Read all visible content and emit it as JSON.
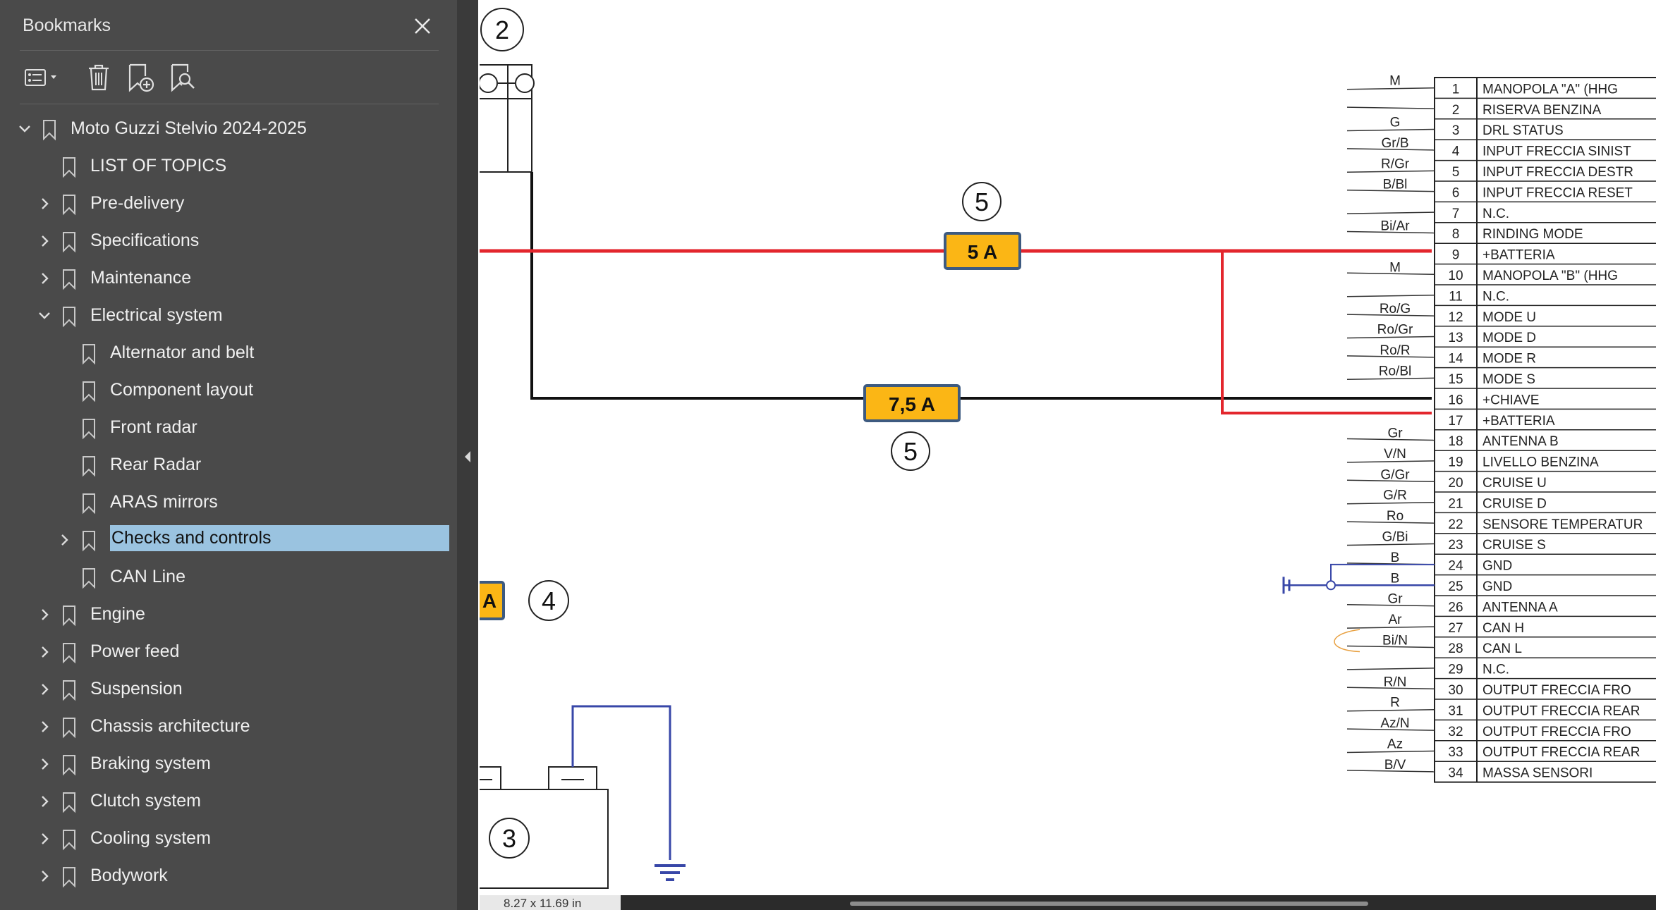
{
  "sidebar": {
    "title": "Bookmarks",
    "tree": [
      {
        "label": "Moto Guzzi Stelvio 2024-2025",
        "level": 0,
        "expander": "expanded"
      },
      {
        "label": "LIST OF TOPICS",
        "level": 1,
        "expander": "none"
      },
      {
        "label": "Pre-delivery",
        "level": 1,
        "expander": "collapsed"
      },
      {
        "label": "Specifications",
        "level": 1,
        "expander": "collapsed"
      },
      {
        "label": "Maintenance",
        "level": 1,
        "expander": "collapsed"
      },
      {
        "label": "Electrical system",
        "level": 1,
        "expander": "expanded"
      },
      {
        "label": "Alternator and belt",
        "level": 2,
        "expander": "none"
      },
      {
        "label": "Component layout",
        "level": 2,
        "expander": "none"
      },
      {
        "label": "Front radar",
        "level": 2,
        "expander": "none"
      },
      {
        "label": "Rear Radar",
        "level": 2,
        "expander": "none"
      },
      {
        "label": "ARAS mirrors",
        "level": 2,
        "expander": "none"
      },
      {
        "label": "Checks and controls",
        "level": 2,
        "expander": "collapsed",
        "selected": true
      },
      {
        "label": "CAN Line",
        "level": 2,
        "expander": "none"
      },
      {
        "label": "Engine",
        "level": 1,
        "expander": "collapsed"
      },
      {
        "label": "Power feed",
        "level": 1,
        "expander": "collapsed"
      },
      {
        "label": "Suspension",
        "level": 1,
        "expander": "collapsed"
      },
      {
        "label": "Chassis architecture",
        "level": 1,
        "expander": "collapsed"
      },
      {
        "label": "Braking system",
        "level": 1,
        "expander": "collapsed"
      },
      {
        "label": "Clutch system",
        "level": 1,
        "expander": "collapsed"
      },
      {
        "label": "Cooling system",
        "level": 1,
        "expander": "collapsed"
      },
      {
        "label": "Bodywork",
        "level": 1,
        "expander": "collapsed"
      }
    ]
  },
  "toolbar": {
    "icons": [
      "options-menu-icon",
      "delete-bookmark-icon",
      "add-bookmark-icon",
      "find-bookmark-icon"
    ]
  },
  "diagram": {
    "callouts": {
      "top_left": "2",
      "fuse_top": "5",
      "fuse_bottom": "5",
      "fuse_left": "4",
      "battery": "3"
    },
    "fuses": {
      "top": "5 A",
      "bottom": "7,5 A",
      "left": "A"
    },
    "wires": [
      "M",
      "",
      "G",
      "Gr/B",
      "R/Gr",
      "B/Bl",
      "",
      "Bi/Ar",
      "",
      "M",
      "",
      "Ro/G",
      "Ro/Gr",
      "Ro/R",
      "Ro/Bl",
      "",
      "",
      "Gr",
      "V/N",
      "G/Gr",
      "G/R",
      "Ro",
      "G/Bi",
      "B",
      "B",
      "Gr",
      "Ar",
      "Bi/N",
      "",
      "R/N",
      "R",
      "Az/N",
      "Az",
      "B/V"
    ],
    "pins": [
      {
        "n": "1",
        "label": "MANOPOLA \"A\" (HHG"
      },
      {
        "n": "2",
        "label": "RISERVA BENZINA"
      },
      {
        "n": "3",
        "label": "DRL STATUS"
      },
      {
        "n": "4",
        "label": "INPUT FRECCIA SINIST"
      },
      {
        "n": "5",
        "label": "INPUT FRECCIA DESTR"
      },
      {
        "n": "6",
        "label": "INPUT FRECCIA RESET"
      },
      {
        "n": "7",
        "label": "N.C."
      },
      {
        "n": "8",
        "label": "RINDING MODE"
      },
      {
        "n": "9",
        "label": "+BATTERIA"
      },
      {
        "n": "10",
        "label": "MANOPOLA \"B\" (HHG"
      },
      {
        "n": "11",
        "label": "N.C."
      },
      {
        "n": "12",
        "label": "MODE U"
      },
      {
        "n": "13",
        "label": "MODE D"
      },
      {
        "n": "14",
        "label": "MODE R"
      },
      {
        "n": "15",
        "label": "MODE S"
      },
      {
        "n": "16",
        "label": "+CHIAVE"
      },
      {
        "n": "17",
        "label": "+BATTERIA"
      },
      {
        "n": "18",
        "label": "ANTENNA B"
      },
      {
        "n": "19",
        "label": "LIVELLO BENZINA"
      },
      {
        "n": "20",
        "label": "CRUISE U"
      },
      {
        "n": "21",
        "label": "CRUISE D"
      },
      {
        "n": "22",
        "label": "SENSORE TEMPERATUR"
      },
      {
        "n": "23",
        "label": "CRUISE S"
      },
      {
        "n": "24",
        "label": "GND"
      },
      {
        "n": "25",
        "label": "GND"
      },
      {
        "n": "26",
        "label": "ANTENNA A"
      },
      {
        "n": "27",
        "label": "CAN H"
      },
      {
        "n": "28",
        "label": "CAN L"
      },
      {
        "n": "29",
        "label": "N.C."
      },
      {
        "n": "30",
        "label": "OUTPUT FRECCIA FRO"
      },
      {
        "n": "31",
        "label": "OUTPUT FRECCIA REAR"
      },
      {
        "n": "32",
        "label": "OUTPUT FRECCIA FRO"
      },
      {
        "n": "33",
        "label": "OUTPUT FRECCIA REAR"
      },
      {
        "n": "34",
        "label": "MASSA SENSORI"
      }
    ],
    "colors": {
      "red_wire": "#e3262d",
      "fuse_fill": "#fbb615",
      "fuse_border": "#3d5a80",
      "ground_blue": "#3847a8"
    }
  },
  "status": {
    "page_size": "8.27 x 11.69 in"
  }
}
